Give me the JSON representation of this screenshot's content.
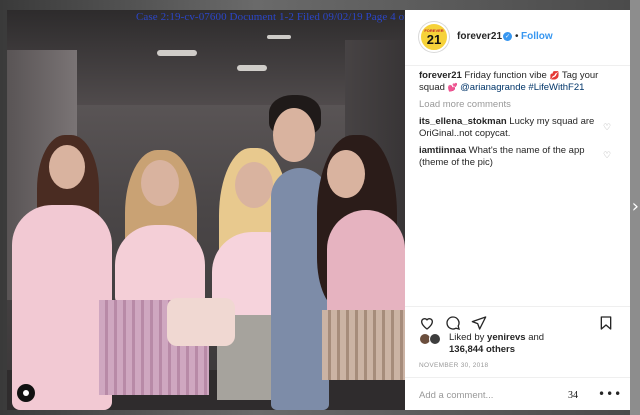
{
  "court_header": "Case 2:19-cv-07600   Document 1-2   Filed 09/02/19   Page 4 of 15   Page ID #:34",
  "post": {
    "avatar": {
      "top_text": "FOREVER",
      "number": "21"
    },
    "username": "forever21",
    "separator": "•",
    "follow_label": "Follow",
    "caption": {
      "username": "forever21",
      "text_1": "Friday function vibe",
      "text_2": "Tag your squad",
      "mention": "@arianagrande",
      "hashtag": "#LifeWithF21"
    },
    "load_more": "Load more comments",
    "comments": [
      {
        "user": "its_ellena_stokman",
        "text": "Lucky my squad are OriGinal..not copycat."
      },
      {
        "user": "iamtiinnaa",
        "text": "What's the name of the app (theme of the pic)"
      }
    ],
    "likes": {
      "prefix": "Liked by",
      "user": "yenirevs",
      "joiner": "and",
      "others": "136,844 others"
    },
    "date": "NOVEMBER 30, 2018",
    "add_comment_placeholder": "Add a comment...",
    "page_number": "34",
    "more_glyph": "•••",
    "icons": [
      "heart-icon",
      "comment-icon",
      "share-icon",
      "bookmark-icon",
      "chevron-right-icon",
      "camera-badge-icon",
      "verified-badge-icon"
    ]
  },
  "colors": {
    "header_blue": "#2b46c8",
    "link_blue": "#3897f0",
    "mention": "#003569",
    "muted": "#999999"
  }
}
